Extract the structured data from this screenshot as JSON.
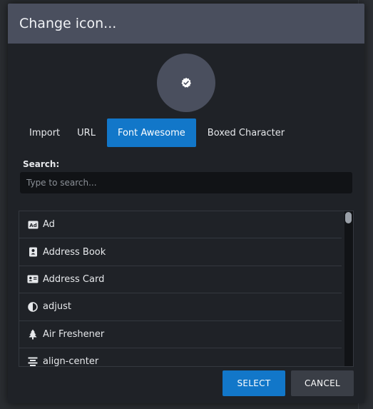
{
  "modal": {
    "title": "Change icon..."
  },
  "tabs": [
    {
      "label": "Import"
    },
    {
      "label": "URL"
    },
    {
      "label": "Font Awesome",
      "active": true
    },
    {
      "label": "Boxed Character"
    }
  ],
  "search": {
    "label": "Search:",
    "placeholder": "Type to search...",
    "value": ""
  },
  "icon_list": [
    {
      "label": "Ad",
      "icon": "ad-icon"
    },
    {
      "label": "Address Book",
      "icon": "address-book-icon"
    },
    {
      "label": "Address Card",
      "icon": "address-card-icon"
    },
    {
      "label": "adjust",
      "icon": "adjust-icon"
    },
    {
      "label": "Air Freshener",
      "icon": "air-freshener-icon"
    },
    {
      "label": "align-center",
      "icon": "align-center-icon"
    }
  ],
  "buttons": {
    "select": "SELECT",
    "cancel": "CANCEL"
  },
  "colors": {
    "accent": "#1277c9",
    "header": "#4a4f5e",
    "modal_bg": "#1f2227"
  }
}
